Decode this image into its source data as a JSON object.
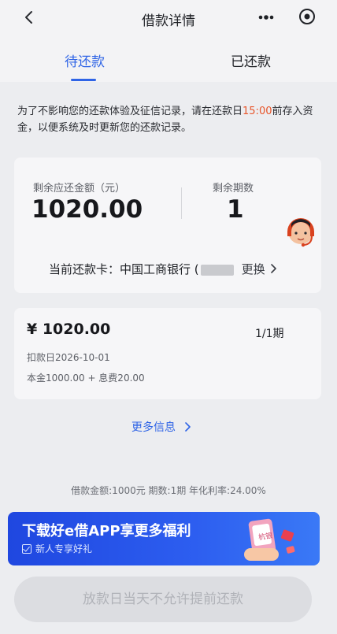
{
  "header": {
    "title": "借款详情",
    "back_icon": "back-chevron-icon",
    "more_icon": "more-dots-icon",
    "close_icon": "target-circle-icon"
  },
  "tabs": [
    {
      "label": "待还款",
      "active": true
    },
    {
      "label": "已还款",
      "active": false
    }
  ],
  "notice": {
    "before": "为了不影响您的还款体验及征信记录，请在还款日",
    "time": "15:00",
    "after": "前存入资金，以便系统及时更新您的还款记录。"
  },
  "summary": {
    "remaining_amount_label": "剩余应还金额（元）",
    "remaining_amount": "1020.00",
    "remaining_periods_label": "剩余期数",
    "remaining_periods": "1",
    "card_label": "当前还款卡：中国工商银行 (",
    "change_label": "更换"
  },
  "bill": {
    "amount": "¥ 1020.00",
    "period": "1/1期",
    "deduct_date": "扣款日2026-10-01",
    "breakdown": "本金1000.00 + 息费20.00"
  },
  "more_info_label": "更多信息",
  "loan_summary": "借款金额:1000元   期数:1期   年化利率:24.00%",
  "banner": {
    "title": "下载好e借APP享更多福利",
    "subtitle": "新人专享好礼",
    "phone_text": "杭银"
  },
  "prepay_button_label": "放款日当天不允许提前还款",
  "colors": {
    "accent": "#2f64e6",
    "highlight": "#e8552a",
    "banner": "#2d5ef0",
    "disabled": "#dcdde1"
  }
}
